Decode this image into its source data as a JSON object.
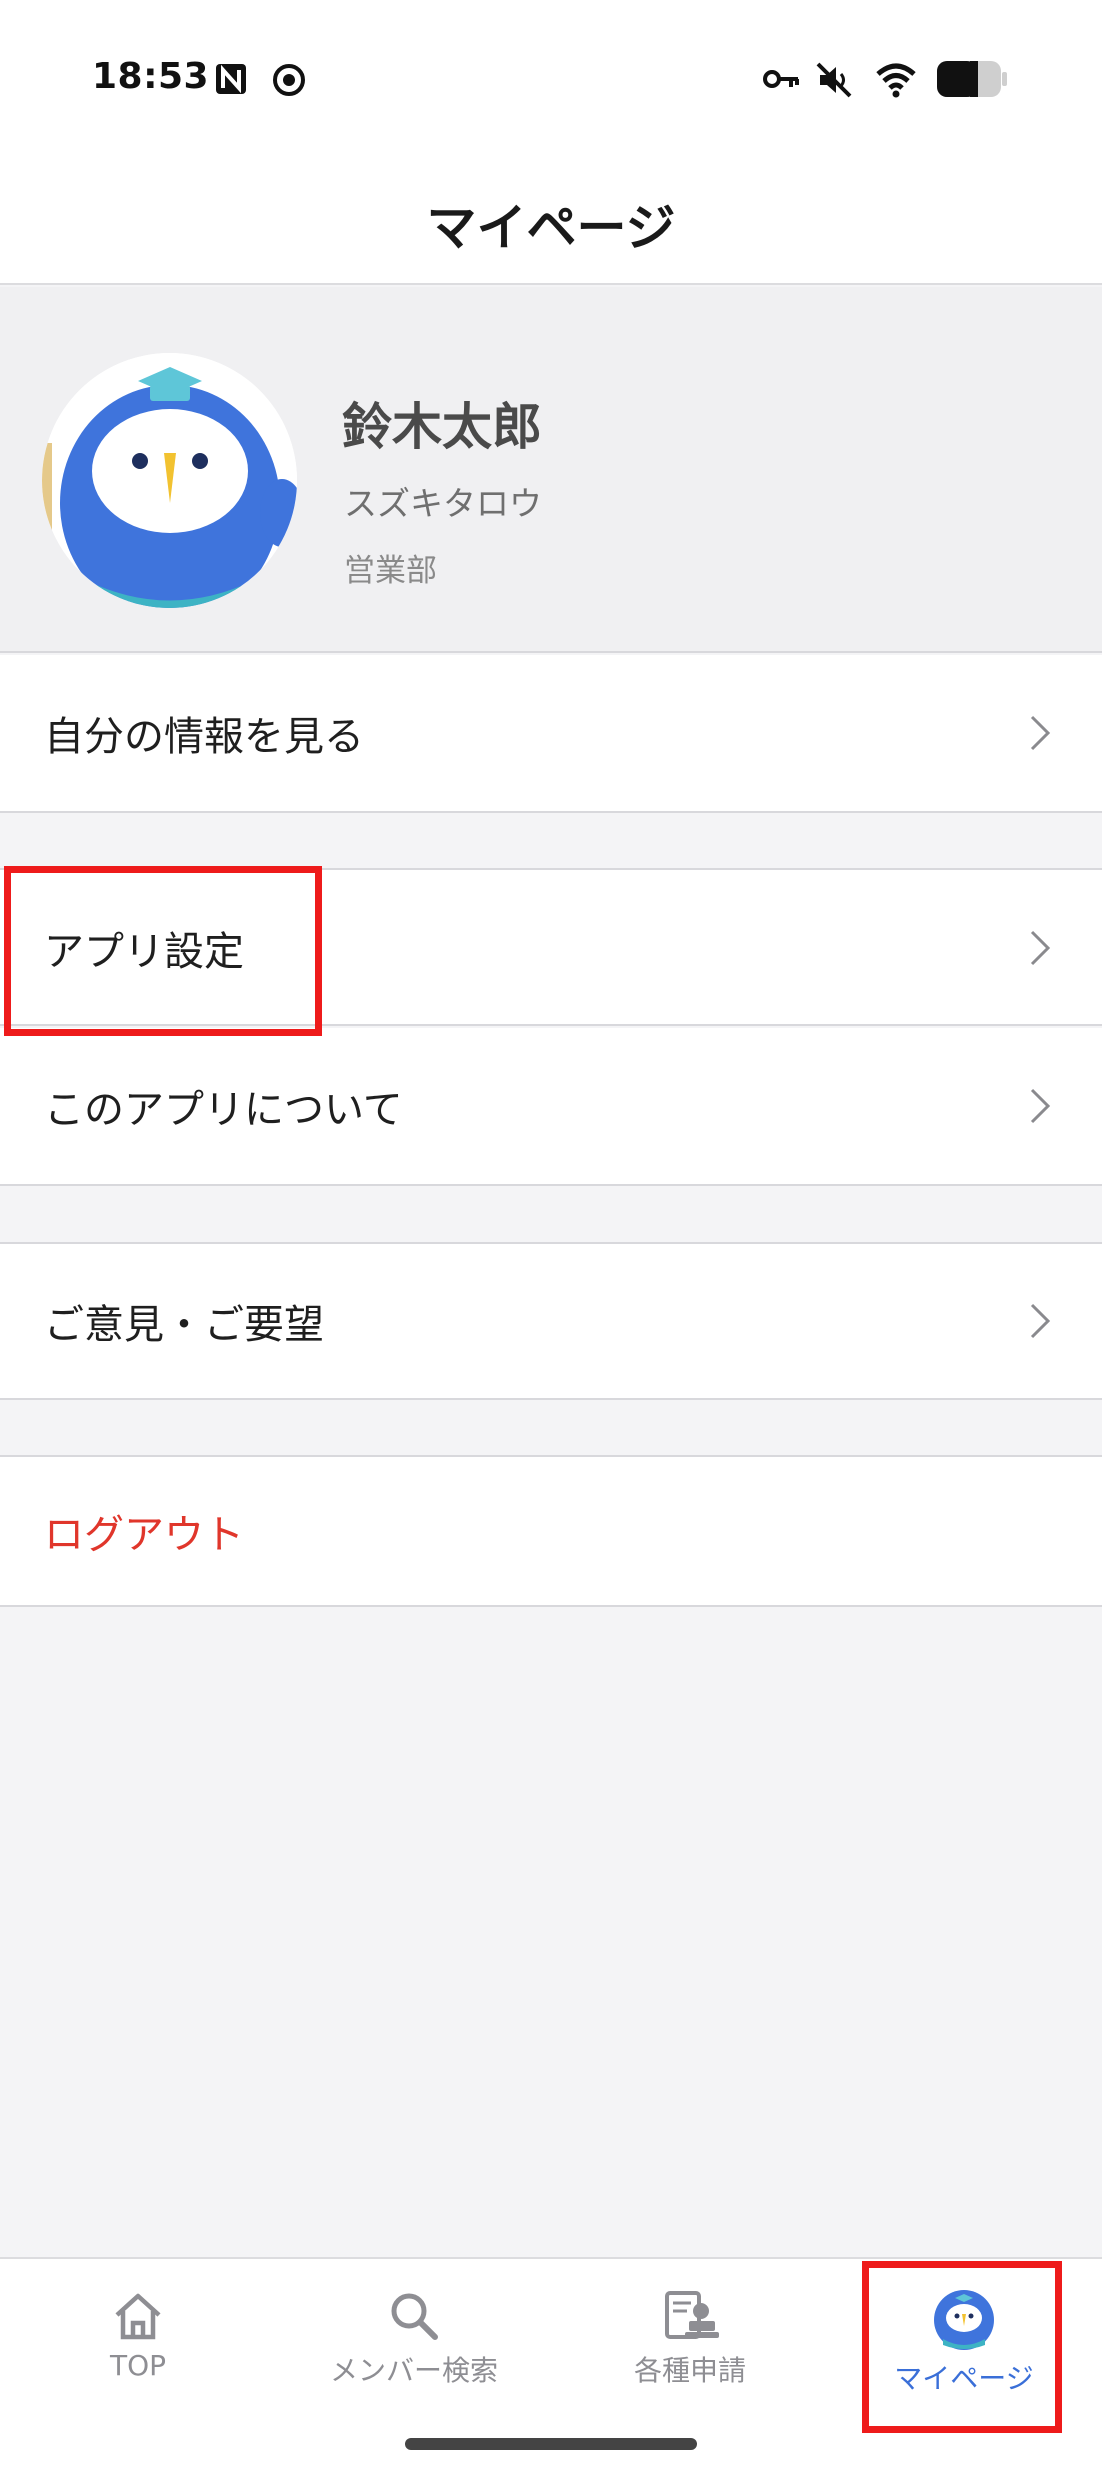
{
  "status_bar": {
    "time": "18:53"
  },
  "header": {
    "title": "マイページ"
  },
  "profile": {
    "name": "鈴木太郎",
    "kana": "スズキタロウ",
    "department": "営業部",
    "avatar_icon": "owl-mascot-icon"
  },
  "menu": {
    "my_info": "自分の情報を見る",
    "app_settings": "アプリ設定",
    "about_app": "このアプリについて",
    "feedback": "ご意見・ご要望",
    "logout": "ログアウト"
  },
  "tabs": [
    {
      "label": "TOP",
      "icon": "home-icon"
    },
    {
      "label": "メンバー検索",
      "icon": "search-icon"
    },
    {
      "label": "各種申請",
      "icon": "application-form-icon"
    },
    {
      "label": "マイページ",
      "icon": "owl-mascot-icon"
    }
  ],
  "colors": {
    "accent": "#3a6fd8",
    "logout": "#e0362b",
    "highlight": "#ee1b1b"
  }
}
